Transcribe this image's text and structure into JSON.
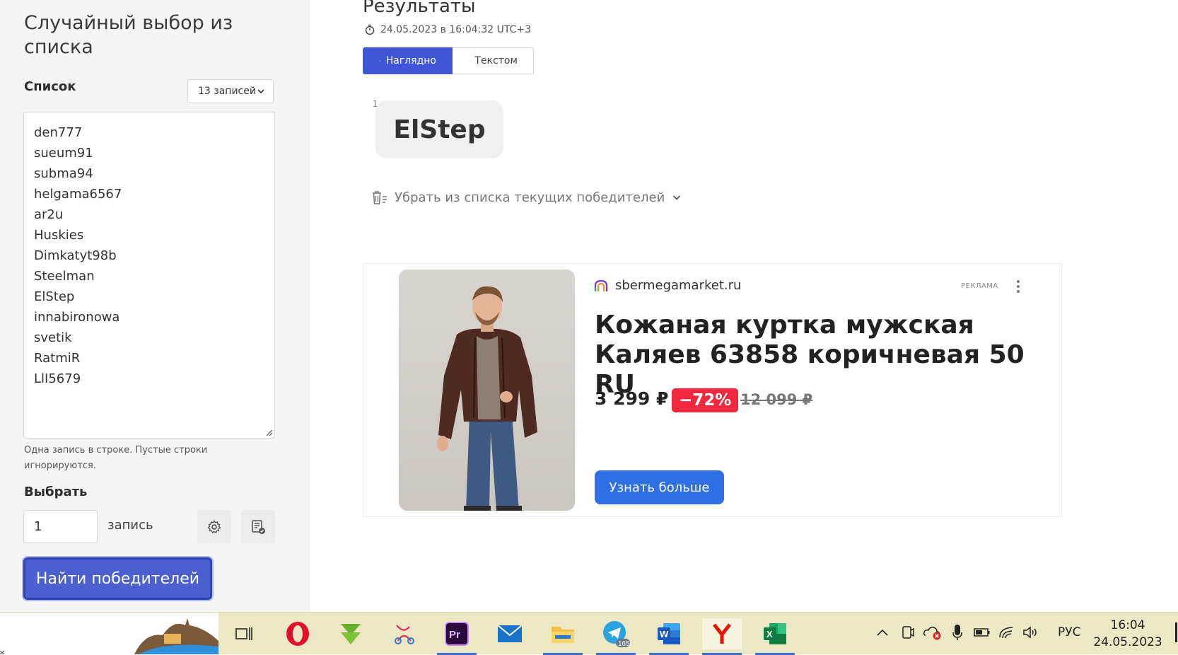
{
  "left": {
    "title": "Случайный выбор из списка",
    "list_label": "Список",
    "count_dropdown": "13 записей",
    "entries": [
      "den777",
      "sueum91",
      "subma94",
      "helgama6567",
      "ar2u",
      "Huskies",
      "Dimkatyt98b",
      "Steelman",
      "ElStep",
      "innabironowa",
      "svetik",
      "RatmiR",
      "LlI5679"
    ],
    "hint": "Одна запись в строке. Пустые строки игнорируются.",
    "pick_label": "Выбрать",
    "quantity": "1",
    "quantity_unit": "запись",
    "find_button": "Найти победителей"
  },
  "results": {
    "title": "Результаты",
    "timestamp": "24.05.2023 в 16:04:32 UTC+3",
    "tabs": [
      {
        "label": "Наглядно",
        "active": true
      },
      {
        "label": "Текстом",
        "active": false
      }
    ],
    "winner_number": "1",
    "winner_name": "ElStep",
    "remove_link": "Убрать из списка текущих победителей"
  },
  "ad": {
    "domain": "sbermegamarket.ru",
    "label": "РЕКЛАМА",
    "title": "Кожаная куртка мужская Каляев 63858 коричневая 50 RU",
    "price": "3 299 ₽",
    "discount": "−72%",
    "old_price": "12 099 ₽",
    "cta": "Узнать больше"
  },
  "taskbar": {
    "apps": [
      "task-view",
      "opera",
      "downloader",
      "paint-app",
      "premiere-pro",
      "mail",
      "file-explorer",
      "telegram",
      "word",
      "yandex-browser",
      "excel"
    ],
    "telegram_badge": "165",
    "language": "РУС",
    "time": "16:04",
    "date": "24.05.2023"
  },
  "colors": {
    "accent": "#3f57d6",
    "find_button": "#4a5fd0",
    "discount_red": "#f1283e",
    "cta_blue": "#2f6fe4",
    "taskbar_bg": "#ede8c4"
  }
}
